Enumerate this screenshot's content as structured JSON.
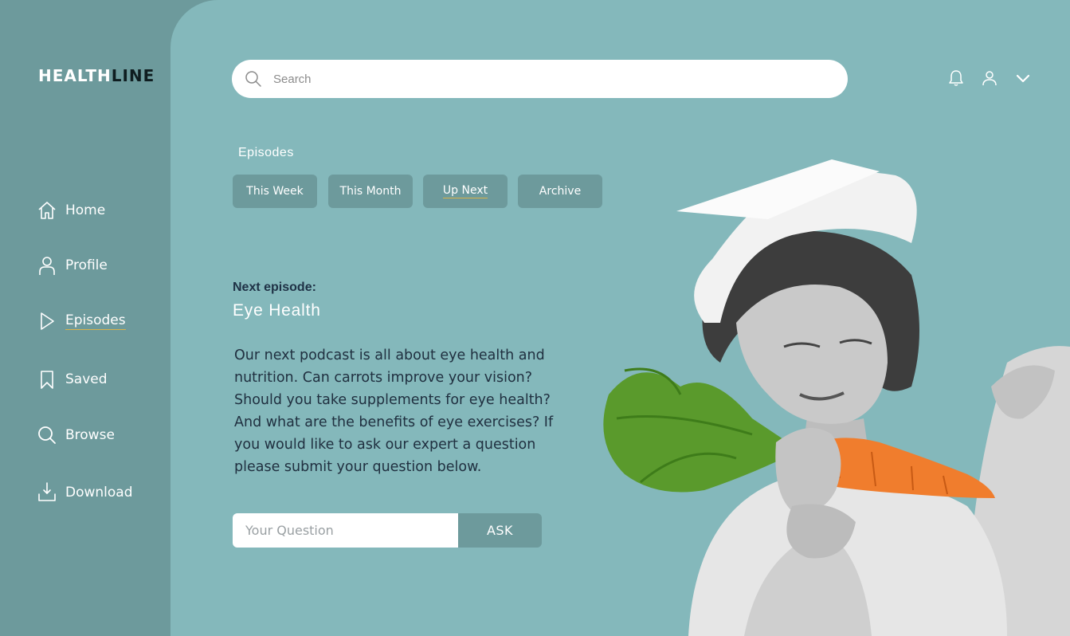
{
  "brand": {
    "logo_part1": "HEALTH",
    "logo_part2": "LINE"
  },
  "sidebar": {
    "items": [
      {
        "label": "Home",
        "icon": "home-icon"
      },
      {
        "label": "Profile",
        "icon": "user-icon"
      },
      {
        "label": "Episodes",
        "icon": "play-icon",
        "active": true
      },
      {
        "label": "Saved",
        "icon": "bookmark-icon"
      },
      {
        "label": "Browse",
        "icon": "search-icon"
      },
      {
        "label": "Download",
        "icon": "download-icon"
      }
    ]
  },
  "search": {
    "placeholder": "Search"
  },
  "header_icons": [
    "bell-icon",
    "user-icon",
    "chevron-down-icon"
  ],
  "episodes": {
    "section_title": "Episodes",
    "tabs": [
      {
        "label": "This Week"
      },
      {
        "label": "This Month"
      },
      {
        "label": "Up Next",
        "active": true
      },
      {
        "label": "Archive"
      }
    ]
  },
  "next_episode": {
    "label": "Next episode:",
    "title": "Eye Health",
    "description": "Our next podcast is all about eye health and nutrition. Can carrots improve your vision? Should you take supplements for eye health? And what are the benefits of eye exercises? If you would like to ask our expert a question please submit your question below."
  },
  "question_form": {
    "placeholder": "Your Question",
    "button_label": "ASK"
  },
  "colors": {
    "sidebar_bg": "#6d9a9c",
    "main_bg": "#84b8bb",
    "accent_underline": "#d7b24a",
    "dark_text": "#1f3246"
  }
}
